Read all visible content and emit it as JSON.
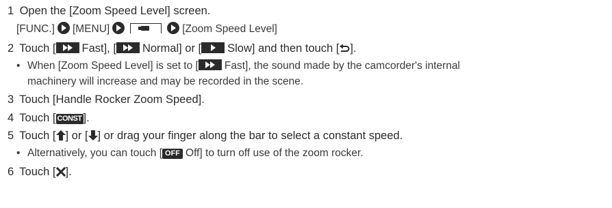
{
  "steps": [
    {
      "number": "1",
      "text": "Open the [Zoom Speed Level] screen.",
      "path": {
        "func": "[FUNC.]",
        "menu": "[MENU]",
        "open_bracket": "[",
        "close_bracket": "]",
        "target": "[Zoom Speed Level]"
      }
    },
    {
      "number": "2",
      "pre": "Touch [",
      "fast": "Fast",
      "sep1": "], [",
      "normal": "Normal",
      "sep2": "] or [",
      "slow": "Slow",
      "post": "] and then touch [",
      "end": "].",
      "bullet": {
        "pre": "When [Zoom Speed Level] is set to [",
        "fast": "Fast",
        "post": "], the sound made by the camcorder's internal",
        "cont": "machinery will increase and may be recorded in the scene."
      }
    },
    {
      "number": "3",
      "text": "Touch [Handle Rocker Zoom Speed]."
    },
    {
      "number": "4",
      "pre": "Touch [",
      "icon_label": "CONST",
      "post": "]."
    },
    {
      "number": "5",
      "pre": "Touch [",
      "mid": "] or [",
      "post": "] or drag your finger along the bar to select a constant speed.",
      "bullet": {
        "pre": "Alternatively, you can touch [",
        "off_icon": "OFF",
        "off_label": "Off",
        "post": "] to turn off use of the zoom rocker."
      }
    },
    {
      "number": "6",
      "pre": "Touch [",
      "post": "]."
    }
  ],
  "bullet_char": "•"
}
